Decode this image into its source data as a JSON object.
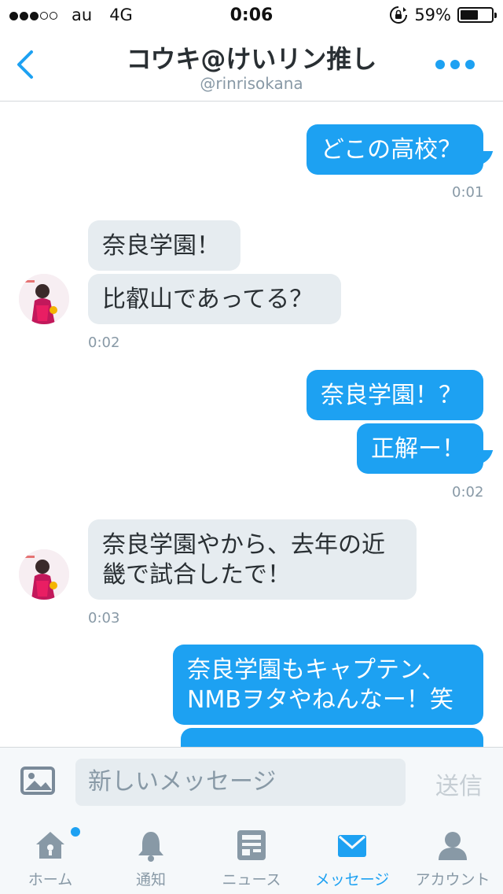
{
  "status_bar": {
    "carrier": "au",
    "network": "4G",
    "time": "0:06",
    "battery_percent": "59%",
    "battery_level": 0.59
  },
  "header": {
    "title": "コウキ@けいリン推し",
    "handle": "@rinrisokana"
  },
  "messages": [
    {
      "text": "どこの高校？"
    },
    {
      "time": "0:01"
    },
    {
      "text": "奈良学園！"
    },
    {
      "text": "比叡山であってる？"
    },
    {
      "time": "0:02"
    },
    {
      "text": "奈良学園！？"
    },
    {
      "text": "正解ー！"
    },
    {
      "time": "0:02"
    },
    {
      "line1": "奈良学園やから、去年の近",
      "line2": "畿で試合したで！"
    },
    {
      "time": "0:03"
    },
    {
      "line1": "奈良学園もキャプテン、",
      "line2": "NMBヲタやねんなー！笑"
    }
  ],
  "compose": {
    "placeholder": "新しいメッセージ",
    "send_label": "送信"
  },
  "tabs": [
    {
      "label": "ホーム"
    },
    {
      "label": "通知"
    },
    {
      "label": "ニュース"
    },
    {
      "label": "メッセージ"
    },
    {
      "label": "アカウント"
    }
  ],
  "colors": {
    "accent": "#1da1f2",
    "incoming_bubble": "#e6ecf0",
    "muted_text": "#8899a6"
  }
}
